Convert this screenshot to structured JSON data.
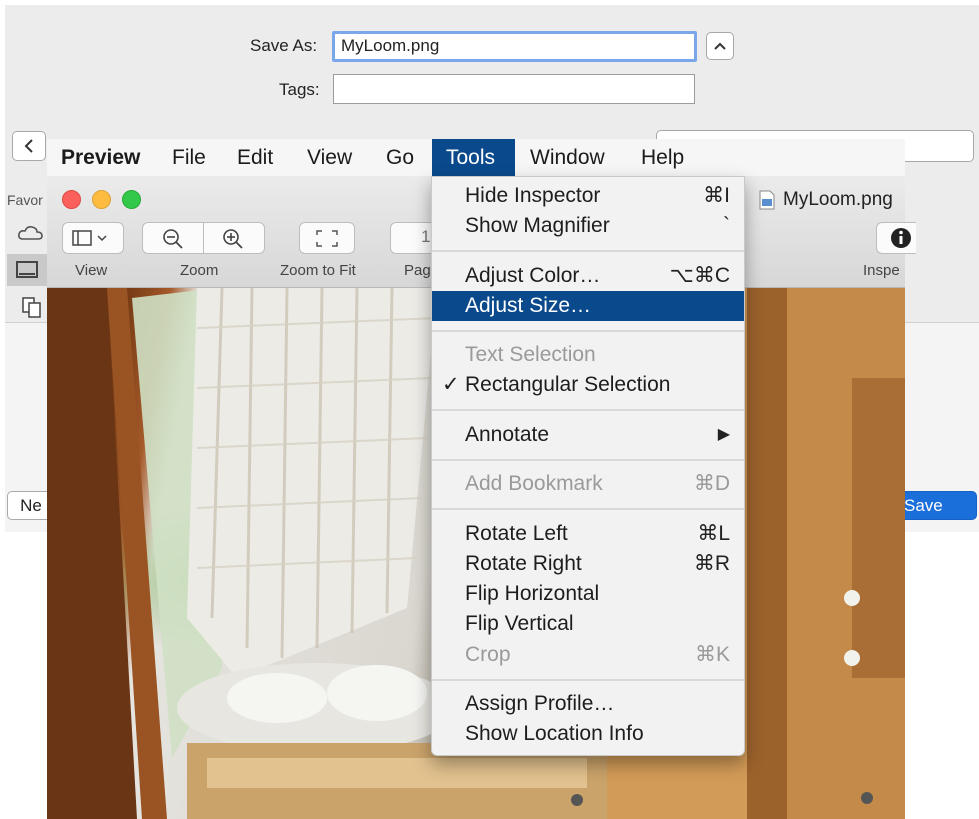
{
  "save_sheet": {
    "save_as_label": "Save As:",
    "save_as_value": "MyLoom.png",
    "tags_label": "Tags:",
    "tags_value": "",
    "sidebar_header": "Favor",
    "new_button": "Ne",
    "save_button": "Save"
  },
  "menubar": {
    "items": [
      "Preview",
      "File",
      "Edit",
      "View",
      "Go",
      "Tools",
      "Window",
      "Help"
    ]
  },
  "window": {
    "filename": "MyLoom.png",
    "toolbar": {
      "view_label": "View",
      "zoom_label": "Zoom",
      "zoom_to_fit_label": "Zoom to Fit",
      "page_label": "Pag",
      "page_value": "1",
      "inspector_label": "Inspe"
    }
  },
  "tools_menu": {
    "items": [
      {
        "label": "Hide Inspector",
        "shortcut": "⌘I",
        "enabled": true
      },
      {
        "label": "Show Magnifier",
        "shortcut": "`",
        "enabled": true
      },
      {
        "label": "Adjust Color…",
        "shortcut": "⌥⌘C",
        "enabled": true
      },
      {
        "label": "Adjust Size…",
        "shortcut": "",
        "enabled": true,
        "highlighted": true
      },
      {
        "label": "Text Selection",
        "shortcut": "",
        "enabled": false
      },
      {
        "label": "Rectangular Selection",
        "shortcut": "",
        "enabled": true,
        "checked": true,
        "check_mark": "✓"
      },
      {
        "label": "Annotate",
        "shortcut": "▶",
        "enabled": true
      },
      {
        "label": "Add Bookmark",
        "shortcut": "⌘D",
        "enabled": false
      },
      {
        "label": "Rotate Left",
        "shortcut": "⌘L",
        "enabled": true
      },
      {
        "label": "Rotate Right",
        "shortcut": "⌘R",
        "enabled": true
      },
      {
        "label": "Flip Horizontal",
        "shortcut": "",
        "enabled": true
      },
      {
        "label": "Flip Vertical",
        "shortcut": "",
        "enabled": true
      },
      {
        "label": "Crop",
        "shortcut": "⌘K",
        "enabled": false
      },
      {
        "label": "Assign Profile…",
        "shortcut": "",
        "enabled": true
      },
      {
        "label": "Show Location Info",
        "shortcut": "",
        "enabled": true
      }
    ]
  },
  "colors": {
    "selection": "#0a4a8c",
    "traffic_close": "#fc605c",
    "traffic_minimize": "#fdbc40",
    "traffic_zoom": "#34c84a"
  }
}
